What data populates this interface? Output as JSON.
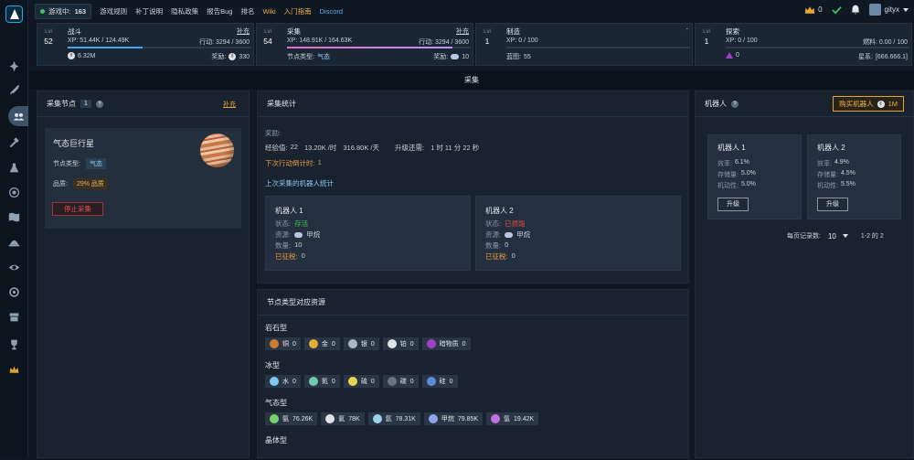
{
  "topbar": {
    "online_label": "游戏中:",
    "online_count": "163",
    "links": [
      "游戏规则",
      "补丁说明",
      "隐私政策",
      "报告Bug",
      "排名",
      "Wiki",
      "入门指南",
      "Discord"
    ],
    "crown_count": "0",
    "username": "gityx"
  },
  "skills": [
    {
      "lvl_label": "Lvl",
      "level": "52",
      "name": "战斗",
      "guide": "补充",
      "xp": "XP: 51.44K / 124.49K",
      "action": "行动: 3294 / 3600",
      "progress": 0.41,
      "left_value": "6.32M",
      "right_label": "奖励:",
      "right_value": "330"
    },
    {
      "lvl_label": "Lvl",
      "level": "54",
      "name": "采集",
      "guide": "补充",
      "xp": "XP: 148.91K / 164.63K",
      "action": "行动: 3294 / 3600",
      "progress": 0.9,
      "left_label": "节点类型:",
      "left_value": "气态",
      "right_label": "奖励:",
      "right_value": "10"
    },
    {
      "lvl_label": "Lvl",
      "level": "1",
      "name": "制造",
      "guide": "-",
      "xp": "XP: 0 / 100",
      "action": "",
      "progress": 0,
      "left_label": "蓝图:",
      "left_value": "55",
      "right_label": "",
      "right_value": ""
    },
    {
      "lvl_label": "Lvl",
      "level": "1",
      "name": "探索",
      "guide": "",
      "xp": "XP: 0 / 100",
      "action": "燃料: 0.00 / 100",
      "progress": 0,
      "left_value": "0",
      "right_label": "星系:",
      "right_value": "[666.666.1]"
    }
  ],
  "banner": "采集",
  "node_panel": {
    "title": "采集节点",
    "count": "1",
    "guide": "补充",
    "node_name": "气态巨行星",
    "type_label": "节点类型:",
    "type_value": "气态",
    "quality_label": "品质:",
    "quality_value": "29% 品质",
    "stop_label": "停止采集"
  },
  "stats_panel": {
    "title": "采集统计",
    "reward_label": "奖励:",
    "exp_label": "经验值:",
    "exp_value": "22",
    "per_hour": "13.20K /时",
    "per_day": "316.80K /天",
    "levelup_label": "升级还需:",
    "levelup_value": "1 时 11 分 22 秒",
    "next_action": "下次行动倒计时:",
    "next_action_value": "1",
    "last_robots_label": "上次采集的机器人统计",
    "robots": [
      {
        "name": "机器人 1",
        "status_label": "状态:",
        "status": "存活",
        "resource_label": "资源:",
        "resource": "甲烷",
        "qty_label": "数量:",
        "qty": "10",
        "tax_label": "已征税:",
        "tax": "0"
      },
      {
        "name": "机器人 2",
        "status_label": "状态:",
        "status": "已损毁",
        "resource_label": "资源:",
        "resource": "甲烷",
        "qty_label": "数量:",
        "qty": "0",
        "tax_label": "已征税:",
        "tax": "0"
      }
    ]
  },
  "resources_panel": {
    "title": "节点类型对应资源",
    "groups": [
      {
        "name": "岩石型",
        "items": [
          {
            "name": "铜",
            "value": "0",
            "color": "#d07a2e"
          },
          {
            "name": "金",
            "value": "0",
            "color": "#e0b030"
          },
          {
            "name": "银",
            "value": "0",
            "color": "#aeb6c0"
          },
          {
            "name": "铂",
            "value": "0",
            "color": "#dfe4ea"
          },
          {
            "name": "暗物质",
            "value": "0",
            "color": "#a040c8"
          }
        ]
      },
      {
        "name": "冰型",
        "items": [
          {
            "name": "水",
            "value": "0",
            "color": "#7ec8ee"
          },
          {
            "name": "氮",
            "value": "0",
            "color": "#6fcab0"
          },
          {
            "name": "硫",
            "value": "0",
            "color": "#e8d650"
          },
          {
            "name": "碳",
            "value": "0",
            "color": "#6b7480"
          },
          {
            "name": "硅",
            "value": "0",
            "color": "#5a8ad8"
          }
        ]
      },
      {
        "name": "气态型",
        "items": [
          {
            "name": "氨",
            "value": "76.26K",
            "color": "#7ad06a"
          },
          {
            "name": "氦",
            "value": "78K",
            "color": "#dfe4ea"
          },
          {
            "name": "氩",
            "value": "78.31K",
            "color": "#9ad0e8"
          },
          {
            "name": "甲烷",
            "value": "79.85K",
            "color": "#8aa8e8"
          },
          {
            "name": "氩",
            "value": "19.42K",
            "color": "#c070e0"
          }
        ]
      },
      {
        "name": "晶体型",
        "items": []
      }
    ]
  },
  "robots_panel": {
    "title": "机器人",
    "buy_label": "购买机器人",
    "buy_price": "1M",
    "cards": [
      {
        "name": "机器人 1",
        "eff_label": "效率:",
        "eff": "6.1%",
        "cap_label": "存储量:",
        "cap": "5.0%",
        "mob_label": "机动性:",
        "mob": "5.0%",
        "btn": "升级"
      },
      {
        "name": "机器人 2",
        "eff_label": "效率:",
        "eff": "4.9%",
        "cap_label": "存储量:",
        "cap": "4.5%",
        "mob_label": "机动性:",
        "mob": "5.5%",
        "btn": "升级"
      }
    ],
    "per_page_label": "每页记录数:",
    "per_page": "10",
    "range": "1-2 的 2"
  }
}
